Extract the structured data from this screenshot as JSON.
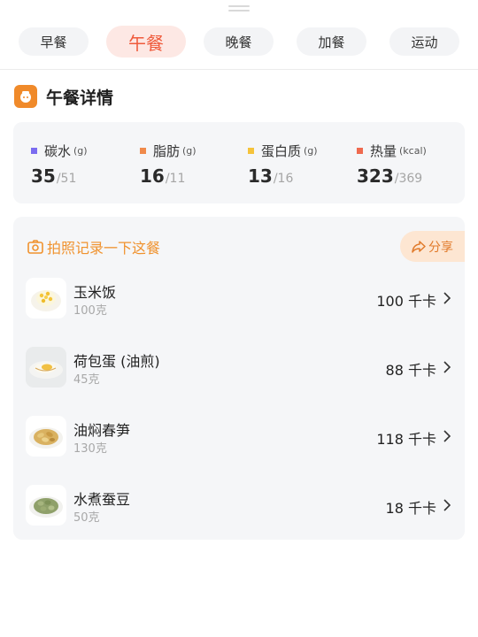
{
  "meal_tabs": [
    "早餐",
    "午餐",
    "晚餐",
    "加餐",
    "运动"
  ],
  "active_tab": "午餐",
  "detail": {
    "title": "午餐详情"
  },
  "macros": [
    {
      "name": "碳水",
      "unit": "(g)",
      "value": "35",
      "target": "/51",
      "color": "#7b6cf0"
    },
    {
      "name": "脂肪",
      "unit": "(g)",
      "value": "16",
      "target": "/11",
      "color": "#f08a4b"
    },
    {
      "name": "蛋白质",
      "unit": "(g)",
      "value": "13",
      "target": "/16",
      "color": "#f5c33b"
    },
    {
      "name": "热量",
      "unit": "(kcal)",
      "value": "323",
      "target": "/369",
      "color": "#ef6a4f"
    }
  ],
  "meal": {
    "photo_prompt": "拍照记录一下这餐",
    "share_label": "分享",
    "foods": [
      {
        "name": "玉米饭",
        "amount": "100克",
        "calories": "100 千卡",
        "icon": "corn-rice"
      },
      {
        "name": "荷包蛋 (油煎)",
        "amount": "45克",
        "calories": "88 千卡",
        "icon": "fried-egg"
      },
      {
        "name": "油焖春笋",
        "amount": "130克",
        "calories": "118 千卡",
        "icon": "braised-bamboo-shoots"
      },
      {
        "name": "水煮蚕豆",
        "amount": "50克",
        "calories": "18 千卡",
        "icon": "boiled-broad-beans"
      }
    ]
  }
}
